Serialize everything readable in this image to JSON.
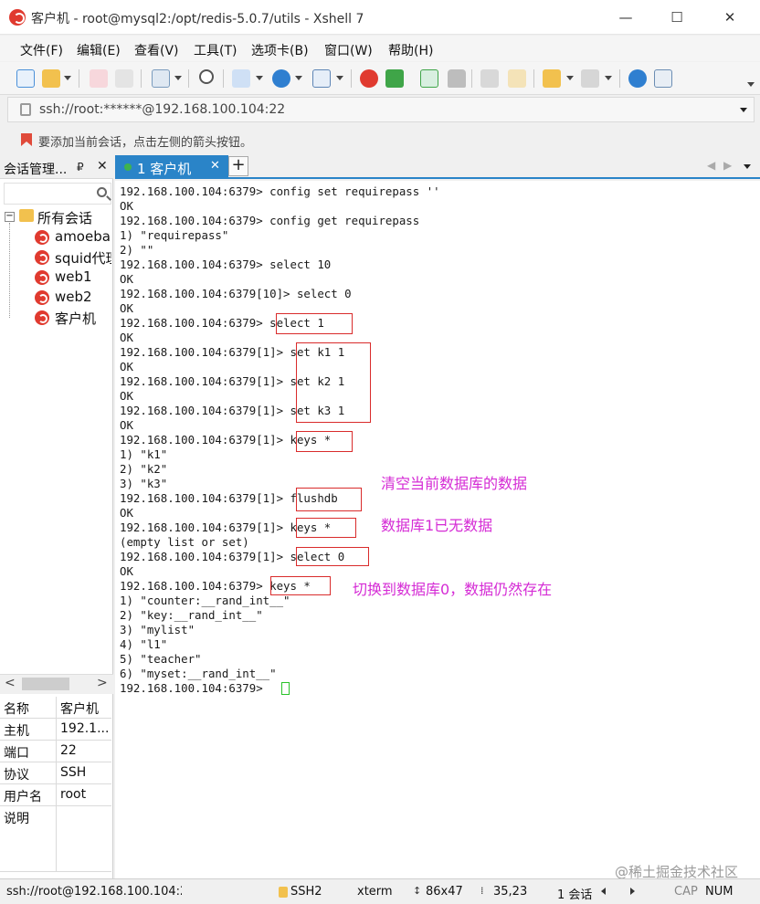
{
  "window": {
    "title": "客户机 - root@mysql2:/opt/redis-5.0.7/utils - Xshell 7",
    "controls": {
      "minimize": "—",
      "maximize": "☐",
      "close": "✕"
    }
  },
  "menu": [
    "文件(F)",
    "编辑(E)",
    "查看(V)",
    "工具(T)",
    "选项卡(B)",
    "窗口(W)",
    "帮助(H)"
  ],
  "address": {
    "value": "ssh://root:******@192.168.100.104:22"
  },
  "hint": {
    "text": "要添加当前会话，点击左侧的箭头按钮。"
  },
  "sidebar": {
    "title": "会话管理...",
    "pin": "₽",
    "close": "✕",
    "tree_root": "所有会话",
    "sessions": [
      "amoeba",
      "squid代理",
      "web1",
      "web2",
      "客户机"
    ],
    "scroll_left": "<",
    "scroll_right": ">"
  },
  "properties": [
    {
      "key": "名称",
      "value": "客户机"
    },
    {
      "key": "主机",
      "value": "192.1..."
    },
    {
      "key": "端口",
      "value": "22"
    },
    {
      "key": "协议",
      "value": "SSH"
    },
    {
      "key": "用户名",
      "value": "root"
    },
    {
      "key": "说明",
      "value": ""
    }
  ],
  "tabs": [
    {
      "label": "1 客户机",
      "close": "✕"
    }
  ],
  "tab_add": "+",
  "terminal_lines": [
    "192.168.100.104:6379> config set requirepass ''",
    "OK",
    "192.168.100.104:6379> config get requirepass",
    "1) \"requirepass\"",
    "2) \"\"",
    "192.168.100.104:6379> select 10",
    "OK",
    "192.168.100.104:6379[10]> select 0",
    "OK",
    "192.168.100.104:6379> select 1",
    "OK",
    "192.168.100.104:6379[1]> set k1 1",
    "OK",
    "192.168.100.104:6379[1]> set k2 1",
    "OK",
    "192.168.100.104:6379[1]> set k3 1",
    "OK",
    "192.168.100.104:6379[1]> keys *",
    "1) \"k1\"",
    "2) \"k2\"",
    "3) \"k3\"",
    "192.168.100.104:6379[1]> flushdb",
    "OK",
    "192.168.100.104:6379[1]> keys *",
    "(empty list or set)",
    "192.168.100.104:6379[1]> select 0",
    "OK",
    "192.168.100.104:6379> keys *",
    "1) \"counter:__rand_int__\"",
    "2) \"key:__rand_int__\"",
    "3) \"mylist\"",
    "4) \"l1\"",
    "5) \"teacher\"",
    "6) \"myset:__rand_int__\"",
    "192.168.100.104:6379> "
  ],
  "annotations": [
    "清空当前数据库的数据",
    "数据库1已无数据",
    "切换到数据库0，数据仍然存在"
  ],
  "status": {
    "connection": "ssh://root@192.168.100.104:2",
    "protocol": "SSH2",
    "terminal": "xterm",
    "size": "86x47",
    "position": "35,23",
    "sessions": "1 会话",
    "caps": "CAP",
    "num": "NUM"
  },
  "watermark": "@稀土掘金技术社区",
  "colors": {
    "accent": "#2a84c8",
    "annotation": "#d52bd5",
    "highlight_box": "#d92b2b",
    "cursor": "#29c229"
  }
}
